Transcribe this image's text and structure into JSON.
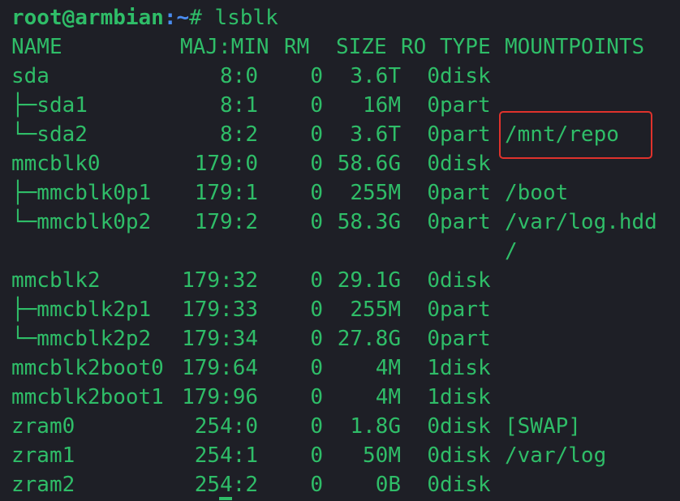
{
  "prompt": {
    "user_host": "root@armbian",
    "path": ":~",
    "symbol": "# ",
    "command": "lsblk"
  },
  "headers": {
    "name": "NAME",
    "majmin": "MAJ:MIN",
    "rm": "RM",
    "size": "SIZE",
    "ro": "RO",
    "type": "TYPE",
    "mountpoints": "MOUNTPOINTS"
  },
  "rows": [
    {
      "name": "sda",
      "majmin": "8:0",
      "rm": "0",
      "size": "3.6T",
      "ro": "0",
      "type": "disk",
      "mount": ""
    },
    {
      "name": "├─sda1",
      "majmin": "8:1",
      "rm": "0",
      "size": "16M",
      "ro": "0",
      "type": "part",
      "mount": ""
    },
    {
      "name": "└─sda2",
      "majmin": "8:2",
      "rm": "0",
      "size": "3.6T",
      "ro": "0",
      "type": "part",
      "mount": "/mnt/repo"
    },
    {
      "name": "mmcblk0",
      "majmin": "179:0",
      "rm": "0",
      "size": "58.6G",
      "ro": "0",
      "type": "disk",
      "mount": ""
    },
    {
      "name": "├─mmcblk0p1",
      "majmin": "179:1",
      "rm": "0",
      "size": "255M",
      "ro": "0",
      "type": "part",
      "mount": "/boot"
    },
    {
      "name": "└─mmcblk0p2",
      "majmin": "179:2",
      "rm": "0",
      "size": "58.3G",
      "ro": "0",
      "type": "part",
      "mount": "/var/log.hdd"
    },
    {
      "name": "",
      "majmin": "",
      "rm": "",
      "size": "",
      "ro": "",
      "type": "",
      "mount": "/"
    },
    {
      "name": "mmcblk2",
      "majmin": "179:32",
      "rm": "0",
      "size": "29.1G",
      "ro": "0",
      "type": "disk",
      "mount": ""
    },
    {
      "name": "├─mmcblk2p1",
      "majmin": "179:33",
      "rm": "0",
      "size": "255M",
      "ro": "0",
      "type": "part",
      "mount": ""
    },
    {
      "name": "└─mmcblk2p2",
      "majmin": "179:34",
      "rm": "0",
      "size": "27.8G",
      "ro": "0",
      "type": "part",
      "mount": ""
    },
    {
      "name": "mmcblk2boot0",
      "majmin": "179:64",
      "rm": "0",
      "size": "4M",
      "ro": "1",
      "type": "disk",
      "mount": ""
    },
    {
      "name": "mmcblk2boot1",
      "majmin": "179:96",
      "rm": "0",
      "size": "4M",
      "ro": "1",
      "type": "disk",
      "mount": ""
    },
    {
      "name": "zram0",
      "majmin": "254:0",
      "rm": "0",
      "size": "1.8G",
      "ro": "0",
      "type": "disk",
      "mount": "[SWAP]"
    },
    {
      "name": "zram1",
      "majmin": "254:1",
      "rm": "0",
      "size": "50M",
      "ro": "0",
      "type": "disk",
      "mount": "/var/log"
    },
    {
      "name": "zram2",
      "majmin": "254:2",
      "rm": "0",
      "size": "0B",
      "ro": "0",
      "type": "disk",
      "mount": ""
    }
  ],
  "colors": {
    "background": "#1e1f26",
    "text": "#2fbd68",
    "path": "#4a8cf0",
    "highlight": "#e0322c"
  }
}
